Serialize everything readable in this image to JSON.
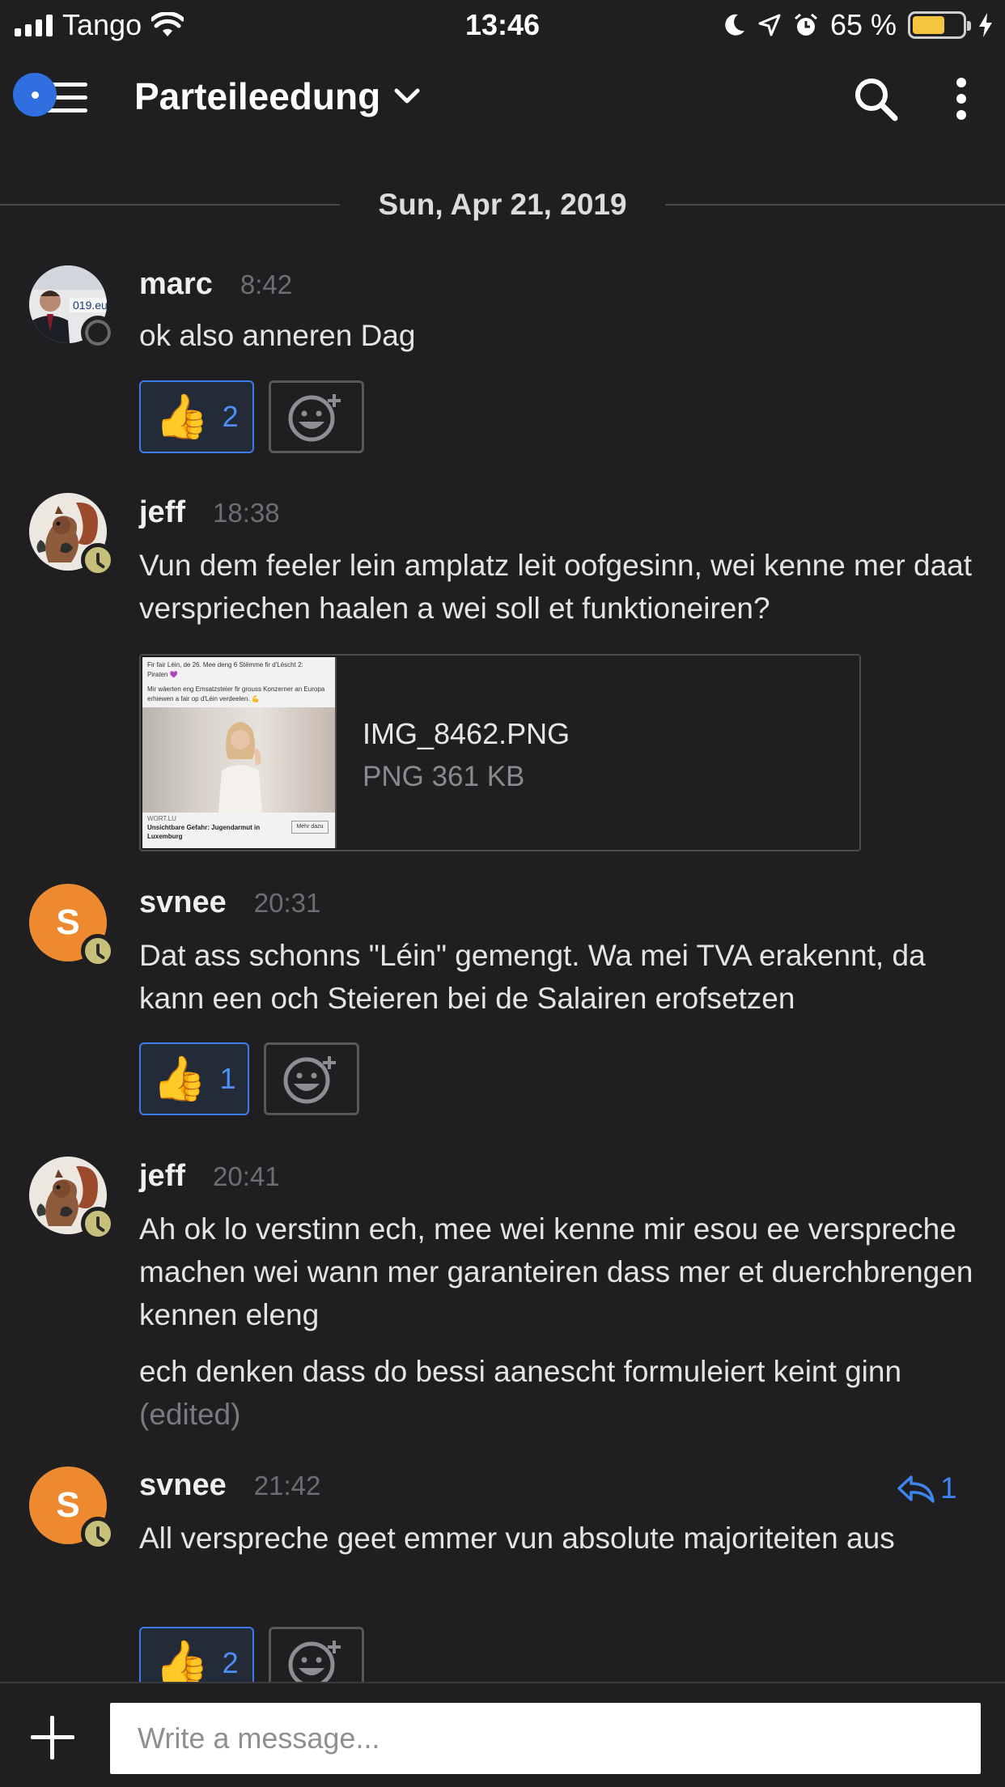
{
  "status_bar": {
    "carrier": "Tango",
    "time": "13:46",
    "battery_percent": "65 %",
    "battery_level": 0.65
  },
  "header": {
    "channel_name": "Parteileedung"
  },
  "date_divider": "Sun, Apr 21, 2019",
  "messages": [
    {
      "username": "marc",
      "time": "8:42",
      "text": "ok also anneren Dag",
      "reaction": {
        "emoji": "👍",
        "count": "2"
      }
    },
    {
      "username": "jeff",
      "time": "18:38",
      "text": "Vun dem feeler lein amplatz leit oofgesinn, wei kenne mer daat verspriechen haalen a wei soll et funktioneiren?",
      "attachment": {
        "file_name": "IMG_8462.PNG",
        "file_info": "PNG 361 KB",
        "thumb_header": "Fir fair Léin, de 26. Mee deng 6 Stëmme fir d'Lëscht 2: Piraten 💜",
        "thumb_body": "Mir wäerten eng Emsatzsteier fir grouss Konzerner an Europa erhiewen a fair op d'Léin verdeelen. 💪",
        "thumb_source": "WORT.LU",
        "thumb_caption": "Unsichtbare Gefahr: Jugendarmut in Luxemburg",
        "thumb_button": "Mehr dazu"
      }
    },
    {
      "username": "svnee",
      "avatar_initial": "S",
      "time": "20:31",
      "text": "Dat ass schonns \"Léin\" gemengt. Wa mei TVA erakennt, da kann een och Steieren bei de Salairen erofsetzen",
      "reaction": {
        "emoji": "👍",
        "count": "1"
      }
    },
    {
      "username": "jeff",
      "time": "20:41",
      "text": "Ah ok lo verstinn ech, mee wei kenne mir esou ee verspreche machen wei wann mer garanteiren dass mer et duerchbrengen kennen eleng",
      "text2": "ech denken dass do bessi aanescht formuleiert keint ginn",
      "edited_label": "(edited)"
    },
    {
      "username": "svnee",
      "avatar_initial": "S",
      "time": "21:42",
      "text": "All verspreche geet emmer vun absolute majoriteiten aus",
      "reply_count": "1",
      "reaction": {
        "emoji": "👍",
        "count": "2"
      }
    }
  ],
  "composer": {
    "placeholder": "Write a message..."
  },
  "colors": {
    "background": "#1f1f21",
    "accent_blue": "#3c7be8",
    "avatar_orange": "#ed8a2f",
    "away_status": "#c7c07a",
    "battery_yellow": "#f5c542"
  },
  "icons": [
    "signal-icon",
    "wifi-icon",
    "moon-icon",
    "location-icon",
    "alarm-icon",
    "battery-icon",
    "charging-icon",
    "menu-icon",
    "chevron-down-icon",
    "search-icon",
    "more-vertical-icon",
    "add-reaction-icon",
    "reply-icon",
    "plus-icon"
  ]
}
